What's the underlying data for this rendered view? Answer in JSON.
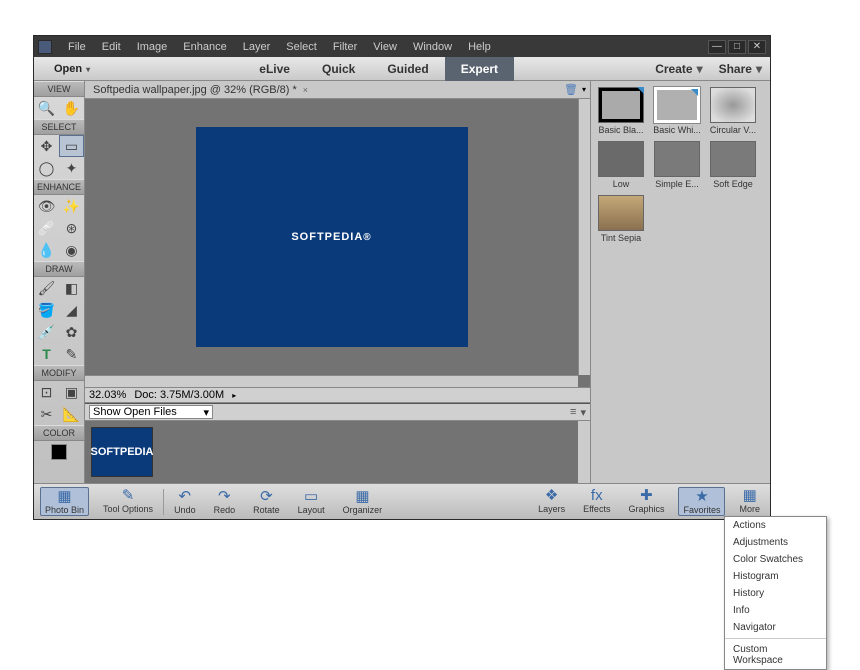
{
  "menubar": [
    "File",
    "Edit",
    "Image",
    "Enhance",
    "Layer",
    "Select",
    "Filter",
    "View",
    "Window",
    "Help"
  ],
  "modebar": {
    "open": "Open",
    "modes": [
      "eLive",
      "Quick",
      "Guided",
      "Expert"
    ],
    "active_mode": "Expert",
    "create": "Create",
    "share": "Share"
  },
  "sections": {
    "view": "VIEW",
    "select": "SELECT",
    "enhance": "ENHANCE",
    "draw": "DRAW",
    "modify": "MODIFY",
    "color": "COLOR"
  },
  "doc_tab": "Softpedia wallpaper.jpg @ 32% (RGB/8) *",
  "canvas_text": "SOFTPEDIA",
  "status": {
    "zoom": "32.03%",
    "doc": "Doc: 3.75M/3.00M"
  },
  "show_open": "Show Open Files",
  "effects": [
    {
      "label": "Basic Bla...",
      "cls": "bb",
      "mark": true
    },
    {
      "label": "Basic Whi...",
      "cls": "bw",
      "mark": true
    },
    {
      "label": "Circular V...",
      "cls": "cv",
      "mark": false
    },
    {
      "label": "Low",
      "cls": "low",
      "mark": false
    },
    {
      "label": "Simple E...",
      "cls": "se",
      "mark": false
    },
    {
      "label": "Soft Edge",
      "cls": "soft",
      "mark": false
    },
    {
      "label": "Tint Sepia",
      "cls": "tint",
      "mark": false
    }
  ],
  "bottom_left": [
    {
      "label": "Photo Bin",
      "icon": "▦"
    },
    {
      "label": "Tool Options",
      "icon": "✎"
    }
  ],
  "bottom_mid": [
    {
      "label": "Undo",
      "icon": "↶"
    },
    {
      "label": "Redo",
      "icon": "↷"
    },
    {
      "label": "Rotate",
      "icon": "⟳"
    },
    {
      "label": "Layout",
      "icon": "▭"
    },
    {
      "label": "Organizer",
      "icon": "▦"
    }
  ],
  "bottom_right": [
    {
      "label": "Layers",
      "icon": "❖"
    },
    {
      "label": "Effects",
      "icon": "fx"
    },
    {
      "label": "Graphics",
      "icon": "✚"
    },
    {
      "label": "Favorites",
      "icon": "★"
    },
    {
      "label": "More",
      "icon": "▦"
    }
  ],
  "more_menu": [
    "Actions",
    "Adjustments",
    "Color Swatches",
    "Histogram",
    "History",
    "Info",
    "Navigator"
  ],
  "more_menu_bottom": "Custom Workspace"
}
